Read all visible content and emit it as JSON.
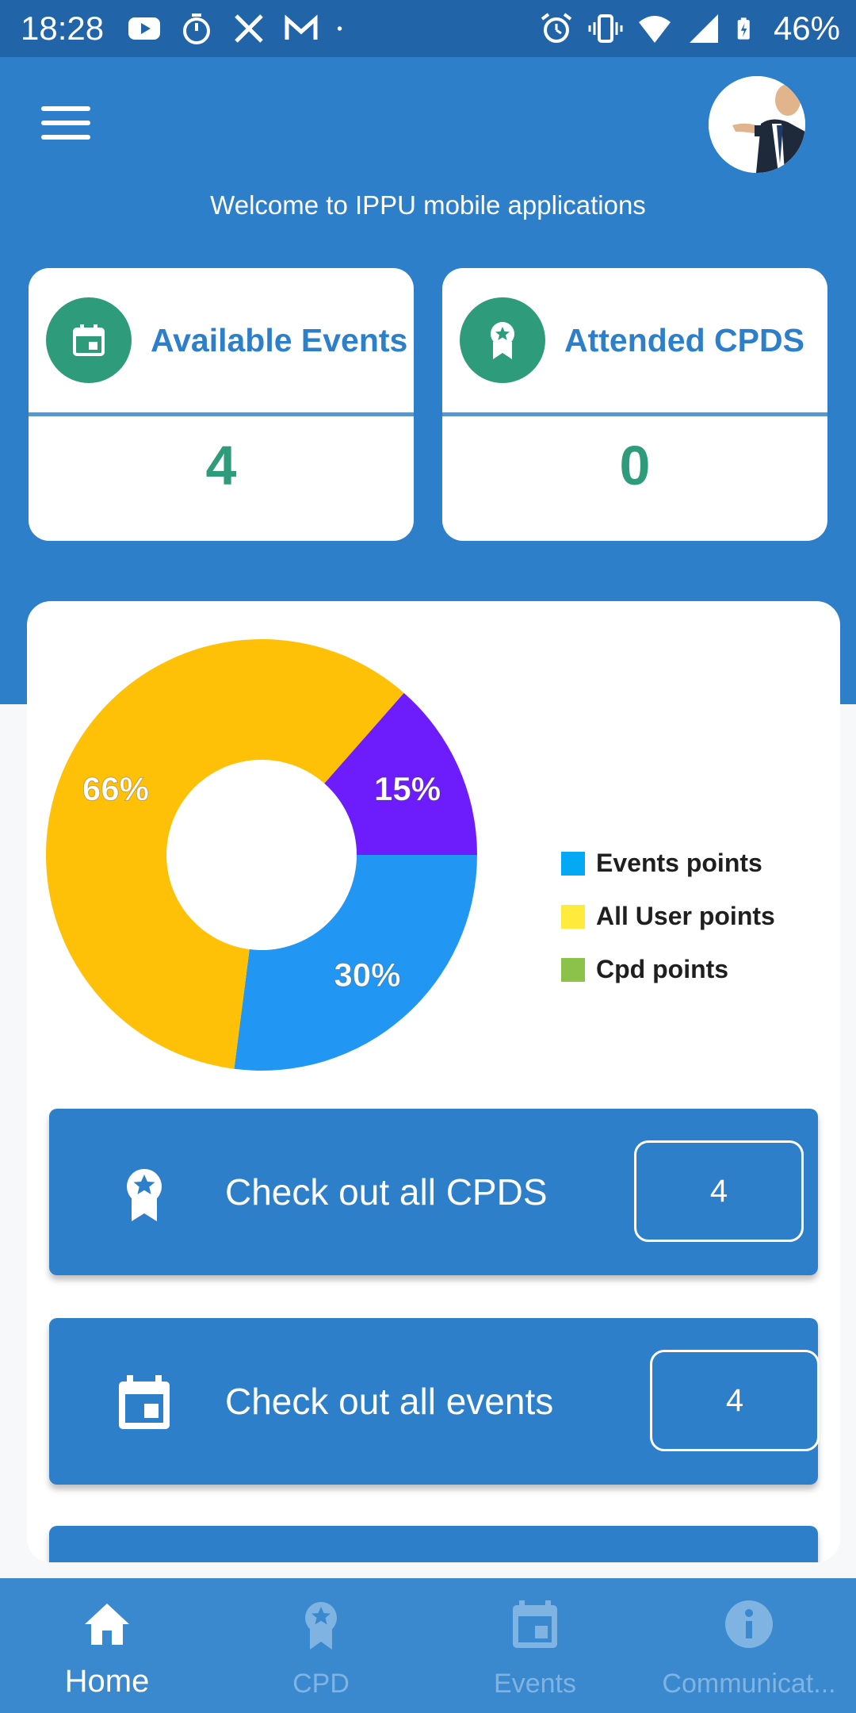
{
  "status_bar": {
    "time": "18:28",
    "battery": "46%",
    "left_icons": [
      "youtube-icon",
      "timer-icon",
      "x-icon",
      "gmail-icon",
      "dot-icon"
    ],
    "right_icons": [
      "alarm-icon",
      "vibrate-icon",
      "wifi-icon",
      "signal-icon",
      "battery-icon"
    ]
  },
  "header": {
    "welcome": "Welcome to IPPU mobile applications",
    "menu_icon": "hamburger-menu-icon",
    "avatar_icon": "profile-avatar"
  },
  "stats": [
    {
      "title": "Available Events",
      "value": "4",
      "icon": "calendar-icon"
    },
    {
      "title": "Attended CPDS",
      "value": "0",
      "icon": "award-icon"
    }
  ],
  "chart_data": {
    "type": "pie",
    "donut": true,
    "slices": [
      {
        "label": "30%",
        "value": 30,
        "color": "#2196f3"
      },
      {
        "label": "66%",
        "value": 66,
        "color": "#ffc107"
      },
      {
        "label": "15%",
        "value": 15,
        "color": "#6d1dfc"
      }
    ],
    "legend": [
      {
        "name": "Events points",
        "color": "#03a9f4"
      },
      {
        "name": "All User points",
        "color": "#ffeb3b"
      },
      {
        "name": "Cpd points",
        "color": "#8bc34a"
      }
    ],
    "legend_position": "right"
  },
  "actions": [
    {
      "label": "Check out all CPDS",
      "count": "4",
      "icon": "award-icon"
    },
    {
      "label": "Check out all events",
      "count": "4",
      "icon": "calendar-icon"
    }
  ],
  "nav": [
    {
      "label": "Home",
      "icon": "home-icon",
      "active": true
    },
    {
      "label": "CPD",
      "icon": "award-icon",
      "active": false
    },
    {
      "label": "Events",
      "icon": "calendar-icon",
      "active": false
    },
    {
      "label": "Communicat...",
      "icon": "info-icon",
      "active": false
    }
  ],
  "colors": {
    "primary": "#2e7fca",
    "status_bar": "#2264a8",
    "accent_green": "#2e9b7b",
    "nav_bg": "#3a88cd"
  }
}
